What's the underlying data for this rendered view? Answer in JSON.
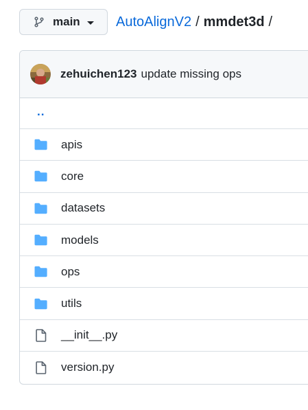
{
  "header": {
    "branch_label": "main",
    "breadcrumb": {
      "repo": "AutoAlignV2",
      "separator": "/",
      "current_dir": "mmdet3d",
      "trailing_separator": "/"
    }
  },
  "commit": {
    "author": "zehuichen123",
    "message": "update missing ops"
  },
  "parent_link": "..",
  "files": [
    {
      "name": "apis",
      "type": "dir",
      "icon": "folder-icon"
    },
    {
      "name": "core",
      "type": "dir",
      "icon": "folder-icon"
    },
    {
      "name": "datasets",
      "type": "dir",
      "icon": "folder-icon"
    },
    {
      "name": "models",
      "type": "dir",
      "icon": "folder-icon"
    },
    {
      "name": "ops",
      "type": "dir",
      "icon": "folder-icon"
    },
    {
      "name": "utils",
      "type": "dir",
      "icon": "folder-icon"
    },
    {
      "name": "__init__.py",
      "type": "file",
      "icon": "file-icon"
    },
    {
      "name": "version.py",
      "type": "file",
      "icon": "file-icon"
    }
  ],
  "colors": {
    "link": "#0969da",
    "folder": "#54aeff",
    "border": "#d0d7de",
    "header_bg": "#f6f8fa",
    "text": "#1f2328"
  }
}
